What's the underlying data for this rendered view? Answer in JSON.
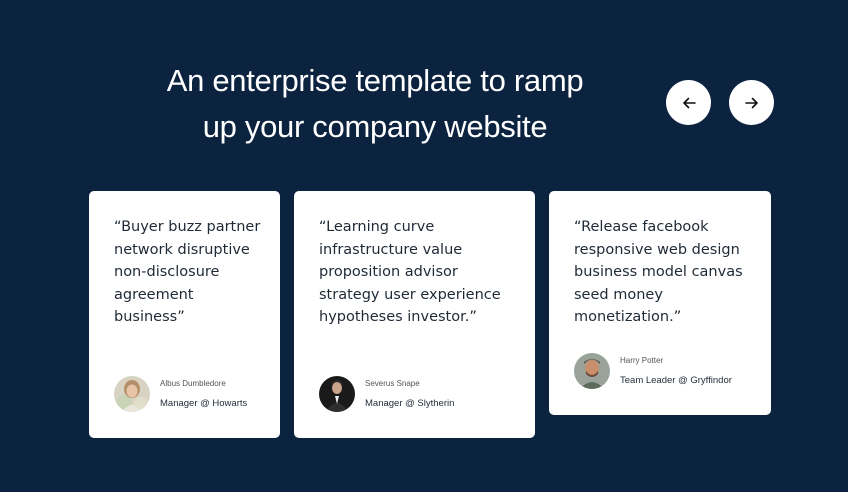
{
  "section": {
    "heading_line1": "An enterprise template to ramp",
    "heading_line2": "up your company website"
  },
  "nav": {
    "prev_icon": "arrow-left-icon",
    "next_icon": "arrow-right-icon"
  },
  "testimonials": [
    {
      "quote": "“Buyer buzz partner network disruptive non-disclosure agreement business”",
      "name": "Albus Dumbledore",
      "role": "Manager @ Howarts"
    },
    {
      "quote": "“Learning curve infrastructure value proposition advisor strategy user experience hypotheses investor.”",
      "name": "Severus Snape",
      "role": "Manager @ Slytherin"
    },
    {
      "quote": "“Release facebook responsive web design business model canvas seed money monetization.”",
      "name": "Harry Potter",
      "role": "Team Leader @ Gryffindor"
    }
  ],
  "colors": {
    "background": "#0c2340",
    "card": "#ffffff",
    "text": "#1f2a37"
  }
}
